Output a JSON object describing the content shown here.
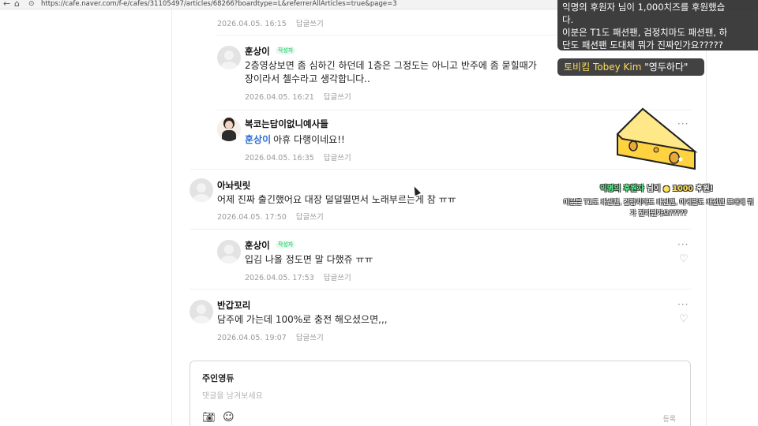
{
  "browser": {
    "url": "https://cafe.naver.com/f-e/cafes/31105497/articles/68266?boardtype=L&referrerAllArticles=true&page=3"
  },
  "reply_label": "답글쓰기",
  "comments": [
    {
      "time": "2026.04.05. 16:15"
    },
    {
      "author": "훈상이",
      "badge": "작성자",
      "lines": [
        "2층영상보면 좀 심하긴 하던데 1층은 그정도는 아니고 반주에 좀 묻힐때가",
        "장이라서 첼수라고 생각합니다.."
      ],
      "time": "2026.04.05. 16:21"
    },
    {
      "author": "복코는답이없니예사들",
      "mention": "훈상이",
      "text": "아휴 다행이네요!!",
      "time": "2026.04.05. 16:35"
    },
    {
      "author": "아놔릿릿",
      "text": "어제 진짜 출긴했어요 대장 덜덜떨면서 노래부르는게 참 ㅠㅠ",
      "time": "2026.04.05. 17:50"
    },
    {
      "author": "훈상이",
      "badge": "작성자",
      "text": "입김 나올 정도면 말 다했쥬 ㅠㅠ",
      "time": "2026.04.05. 17:53"
    },
    {
      "author": "반갑꼬리",
      "text": "담주에 가는데 100%로 충전 해오셨으면,,,",
      "time": "2026.04.05. 19:07"
    }
  ],
  "comment_writer": {
    "name": "주인영듀",
    "placeholder": "댓글을 남겨보세요",
    "submit": "등록"
  },
  "stream_overlay": {
    "chat_lines": [
      "익명의 후원자 님이 1,000치즈를 후원했습",
      "다.",
      "이분은 T1도 패션팬, 검정치마도 패션팬, 하",
      "단도 패션팬 도대체 뭐가 진짜인가요?????"
    ],
    "streamer_name_ko": "토비킴",
    "streamer_name_en": "Tobey Kim",
    "streamer_message": "\"영두하다\"",
    "donor": "익명의 후원자",
    "donor_suffix": "님이",
    "amount": "1000",
    "amount_suffix": "후원!",
    "donation_message": "이분은 T1도 패션팬, 검정치마도 패션팬, 이게단도 패션팬 도대체 뭐가 진짜인가요?????"
  },
  "colors": {
    "badge_green": "#03c75a",
    "mention_blue": "#2c6fd4",
    "meta_gray": "#999999",
    "cheese": "#ffd23f"
  },
  "icons": {
    "back": "arrow-left-icon",
    "home": "home-icon",
    "more": "more-options-icon",
    "like": "heart-icon",
    "camera": "camera-icon",
    "emoji": "smiley-icon"
  }
}
